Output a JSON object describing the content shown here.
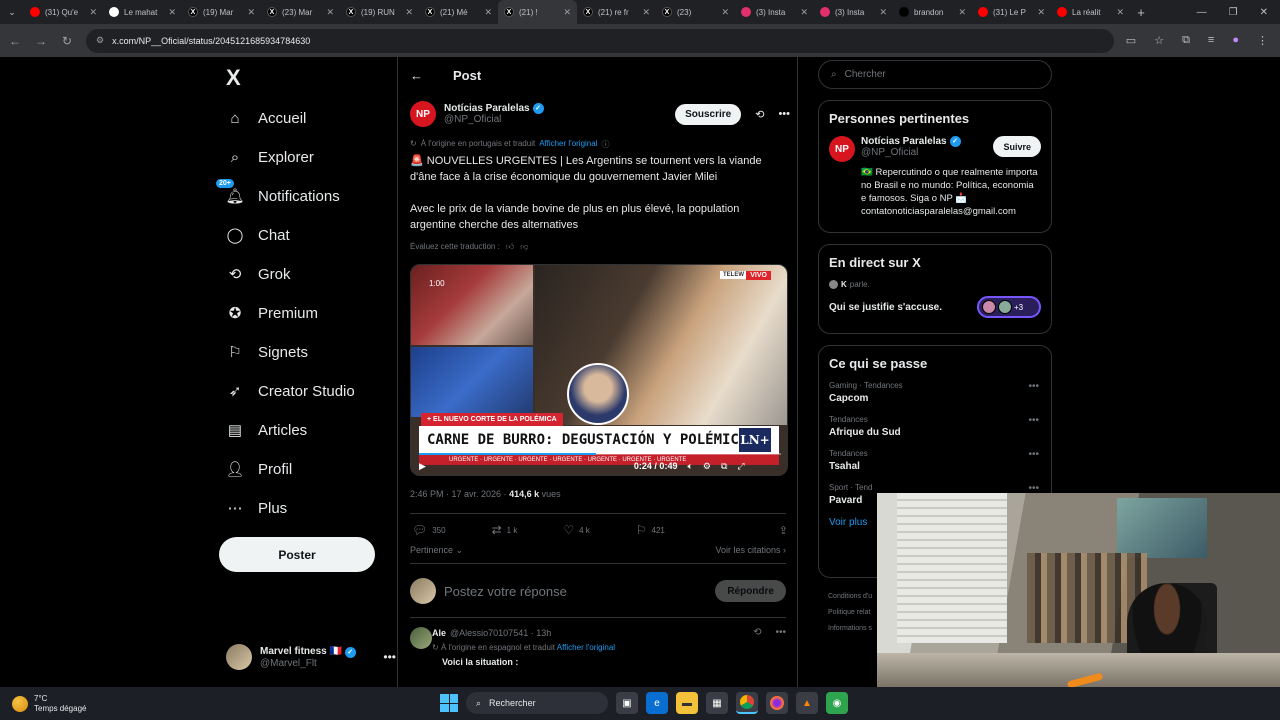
{
  "browser": {
    "tabs": [
      {
        "title": "(31) Qu'e",
        "icon": "youtube-icon",
        "color": "#ff0000"
      },
      {
        "title": "Le mahat",
        "icon": "google-icon",
        "color": "#ffffff"
      },
      {
        "title": "(19) Mar",
        "icon": "x-icon",
        "color": "#000000"
      },
      {
        "title": "(23) Mar",
        "icon": "x-icon",
        "color": "#000000"
      },
      {
        "title": "(19) RUN",
        "icon": "x-icon",
        "color": "#000000"
      },
      {
        "title": "(21) Mé",
        "icon": "x-icon",
        "color": "#000000"
      },
      {
        "title": "(21) !",
        "icon": "x-icon",
        "color": "#000000",
        "active": true
      },
      {
        "title": "(21) re fr",
        "icon": "x-icon",
        "color": "#000000"
      },
      {
        "title": "(23)",
        "icon": "x-icon",
        "color": "#000000"
      },
      {
        "title": "(3) Insta",
        "icon": "instagram-icon",
        "color": "#e1306c"
      },
      {
        "title": "(3) Insta",
        "icon": "instagram-icon",
        "color": "#e1306c"
      },
      {
        "title": "brandon",
        "icon": "tiktok-icon",
        "color": "#000000"
      },
      {
        "title": "(31) Le P",
        "icon": "youtube-icon",
        "color": "#ff0000"
      },
      {
        "title": "La réalit",
        "icon": "youtube-icon",
        "color": "#ff0000"
      }
    ],
    "url": "x.com/NP__Oficial/status/2045121685934784630"
  },
  "nav": {
    "logo": "X",
    "items": [
      {
        "label": "Accueil",
        "icon": "home-icon"
      },
      {
        "label": "Explorer",
        "icon": "search-icon"
      },
      {
        "label": "Notifications",
        "icon": "bell-icon",
        "badge": "20+"
      },
      {
        "label": "Chat",
        "icon": "chat-icon"
      },
      {
        "label": "Grok",
        "icon": "grok-icon"
      },
      {
        "label": "Premium",
        "icon": "premium-icon"
      },
      {
        "label": "Signets",
        "icon": "bookmark-icon"
      },
      {
        "label": "Creator Studio",
        "icon": "rocket-icon"
      },
      {
        "label": "Articles",
        "icon": "article-icon"
      },
      {
        "label": "Profil",
        "icon": "profile-icon"
      },
      {
        "label": "Plus",
        "icon": "more-icon"
      }
    ],
    "post_button": "Poster",
    "me": {
      "name": "Marvel fitness 🇫🇷",
      "handle": "@Marvel_Flt"
    }
  },
  "post": {
    "header": "Post",
    "author": {
      "avatar": "NP",
      "name": "Notícias Paralelas",
      "handle": "@NP_Oficial"
    },
    "subscribe": "Souscrire",
    "translated_note": "À l'origine en portugais et traduit",
    "show_original": "Afficher l'original",
    "text_1": "🚨 NOUVELLES URGENTES | Les Argentins se tournent vers la viande d'âne face à la crise économique du gouvernement Javier Milei",
    "text_2": "Avec le prix de la viande bovine de plus en plus élevé, la population argentine cherche des alternatives",
    "evaluate": "Évaluez cette traduction :",
    "video": {
      "time_overlay": "1:00",
      "tn_label": "TELEW",
      "live_label": "VIVO",
      "red_banner": "+ EL NUEVO CORTE DE LA POLÉMICA",
      "banner": "CARNE DE BURRO: DEGUSTACIÓN Y POLÉMICA",
      "logo": "LN+",
      "ticker": "URGENTE · URGENTE · URGENTE · URGENTE · URGENTE · URGENTE · URGENTE",
      "current": "0:24 / 0:49",
      "progress": 0.49
    },
    "timestamp": "2:46 PM · 17 avr. 2026 · ",
    "views": "414,6 k",
    "views_label": " vues",
    "stats": {
      "replies": "350",
      "reposts": "1 k",
      "likes": "4 k",
      "bookmarks": "421"
    },
    "sort_label": "Pertinence",
    "quotes_label": "Voir les citations",
    "reply_placeholder": "Postez votre réponse",
    "reply_button": "Répondre",
    "first_reply": {
      "name": "Ale",
      "handle": "@Alessio70107541 · 13h",
      "translated_note": "À l'origine en espagnol et traduit",
      "show_original": "Afficher l'original",
      "text": "Voici la situation :"
    }
  },
  "sidebar": {
    "search_placeholder": "Chercher",
    "relevant": {
      "title": "Personnes pertinentes",
      "name": "Notícias Paralelas",
      "handle": "@NP_Oficial",
      "follow": "Suivre",
      "bio": "🇧🇷 Repercutindo o que realmente importa no Brasil e no mundo: Política, economia e famosos. Siga o NP 📩 contatonoticiasparalelas@gmail.com"
    },
    "live": {
      "title": "En direct sur X",
      "host": "K",
      "host_suffix": "parle.",
      "space_title": "Qui se justifie s'accuse.",
      "more": "+3"
    },
    "trends": {
      "title": "Ce qui se passe",
      "items": [
        {
          "category": "Gaming · Tendances",
          "name": "Capcom"
        },
        {
          "category": "Tendances",
          "name": "Afrique du Sud"
        },
        {
          "category": "Tendances",
          "name": "Tsahal"
        },
        {
          "category": "Sport · Tend",
          "name": "Pavard"
        }
      ],
      "more": "Voir plus"
    },
    "footer": [
      "Conditions d'u",
      "Politique relat",
      "Informations s"
    ]
  },
  "taskbar": {
    "temp": "7°C",
    "weather": "Temps dégagé",
    "search": "Rechercher"
  }
}
